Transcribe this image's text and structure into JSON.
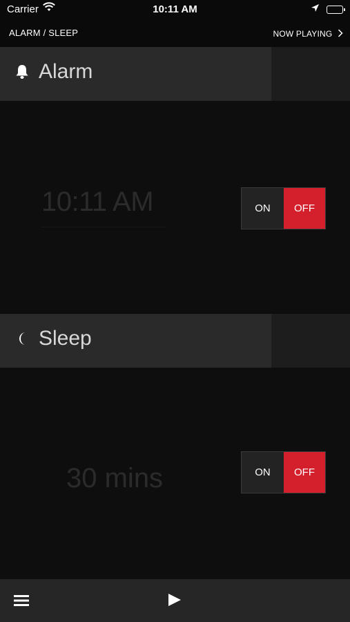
{
  "status_bar": {
    "carrier": "Carrier",
    "time": "10:11 AM",
    "icons": [
      "wifi-icon",
      "location-arrow-icon",
      "battery-icon"
    ]
  },
  "nav": {
    "title": "ALARM / SLEEP",
    "now_playing": "NOW PLAYING"
  },
  "alarm": {
    "header": "Alarm",
    "icon": "bell-icon",
    "time": "10:11 AM",
    "toggle": {
      "on_label": "ON",
      "off_label": "OFF",
      "selected": "OFF"
    }
  },
  "sleep": {
    "header": "Sleep",
    "icon": "moon-icon",
    "duration": "30 mins",
    "toggle": {
      "on_label": "ON",
      "off_label": "OFF",
      "selected": "OFF"
    }
  },
  "tab_bar": {
    "icons": [
      "menu-icon",
      "play-icon"
    ]
  },
  "colors": {
    "accent_red": "#d41f2c",
    "background": "#0e0e0e",
    "header_bg": "#2a2a2a"
  }
}
